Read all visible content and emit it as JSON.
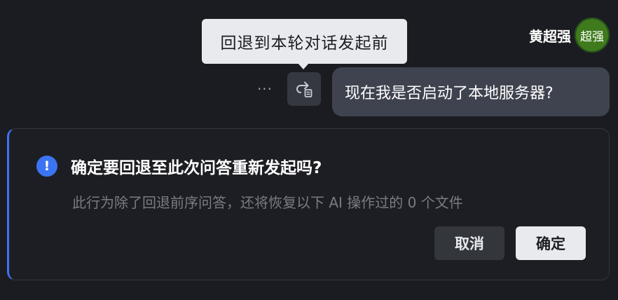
{
  "tooltip": {
    "text": "回退到本轮对话发起前"
  },
  "user": {
    "name": "黄超强",
    "avatar_text": "超强",
    "avatar_color": "#3f7a1c"
  },
  "message": {
    "more_icon": "ellipsis-icon",
    "more_label": "···",
    "rollback_icon": "rollback-icon",
    "text": "现在我是否启动了本地服务器?"
  },
  "confirm": {
    "icon": "exclamation-circle-icon",
    "icon_label": "!",
    "title": "确定要回退至此次问答重新发起吗?",
    "description": "此行为除了回退前序问答，还将恢复以下 AI 操作过的 0 个文件",
    "cancel_label": "取消",
    "ok_label": "确定"
  },
  "colors": {
    "background": "#1b1c21",
    "accent": "#3b74f2",
    "bubble": "#3f434f",
    "tooltip": "#e9eaee"
  }
}
